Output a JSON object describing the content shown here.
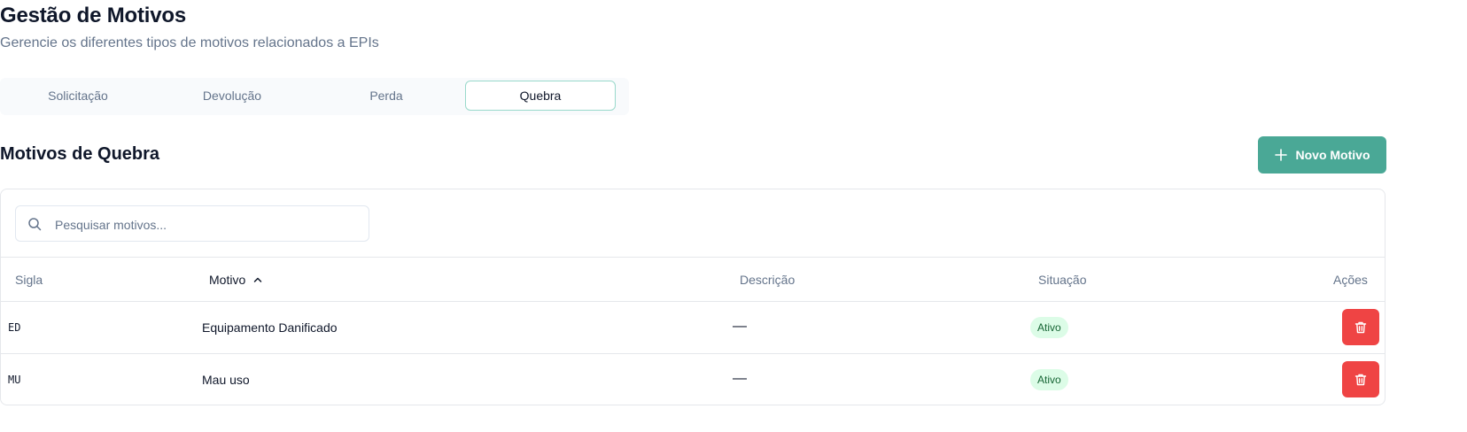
{
  "header": {
    "title": "Gestão de Motivos",
    "subtitle": "Gerencie os diferentes tipos de motivos relacionados a EPIs"
  },
  "tabs": [
    {
      "label": "Solicitação",
      "active": false
    },
    {
      "label": "Devolução",
      "active": false
    },
    {
      "label": "Perda",
      "active": false
    },
    {
      "label": "Quebra",
      "active": true
    }
  ],
  "section": {
    "title": "Motivos de Quebra",
    "new_button_label": "Novo Motivo",
    "new_button_icon": "plus-icon"
  },
  "search": {
    "placeholder": "Pesquisar motivos...",
    "value": "",
    "icon": "search-icon"
  },
  "table": {
    "columns": {
      "sigla": "Sigla",
      "motivo": "Motivo",
      "descricao": "Descrição",
      "situacao": "Situação",
      "acoes": "Ações"
    },
    "sort": {
      "column": "motivo",
      "direction": "asc",
      "icon": "chevron-up-icon"
    },
    "rows": [
      {
        "sigla": "ED",
        "motivo": "Equipamento Danificado",
        "descricao": "—",
        "situacao": "Ativo",
        "action_icon": "trash-icon"
      },
      {
        "sigla": "MU",
        "motivo": "Mau uso",
        "descricao": "—",
        "situacao": "Ativo",
        "action_icon": "trash-icon"
      }
    ]
  },
  "colors": {
    "primary": "#4aa896",
    "danger": "#ef4444",
    "badge_bg": "#dcfce7",
    "badge_text": "#166534",
    "muted_text": "#64748b"
  }
}
